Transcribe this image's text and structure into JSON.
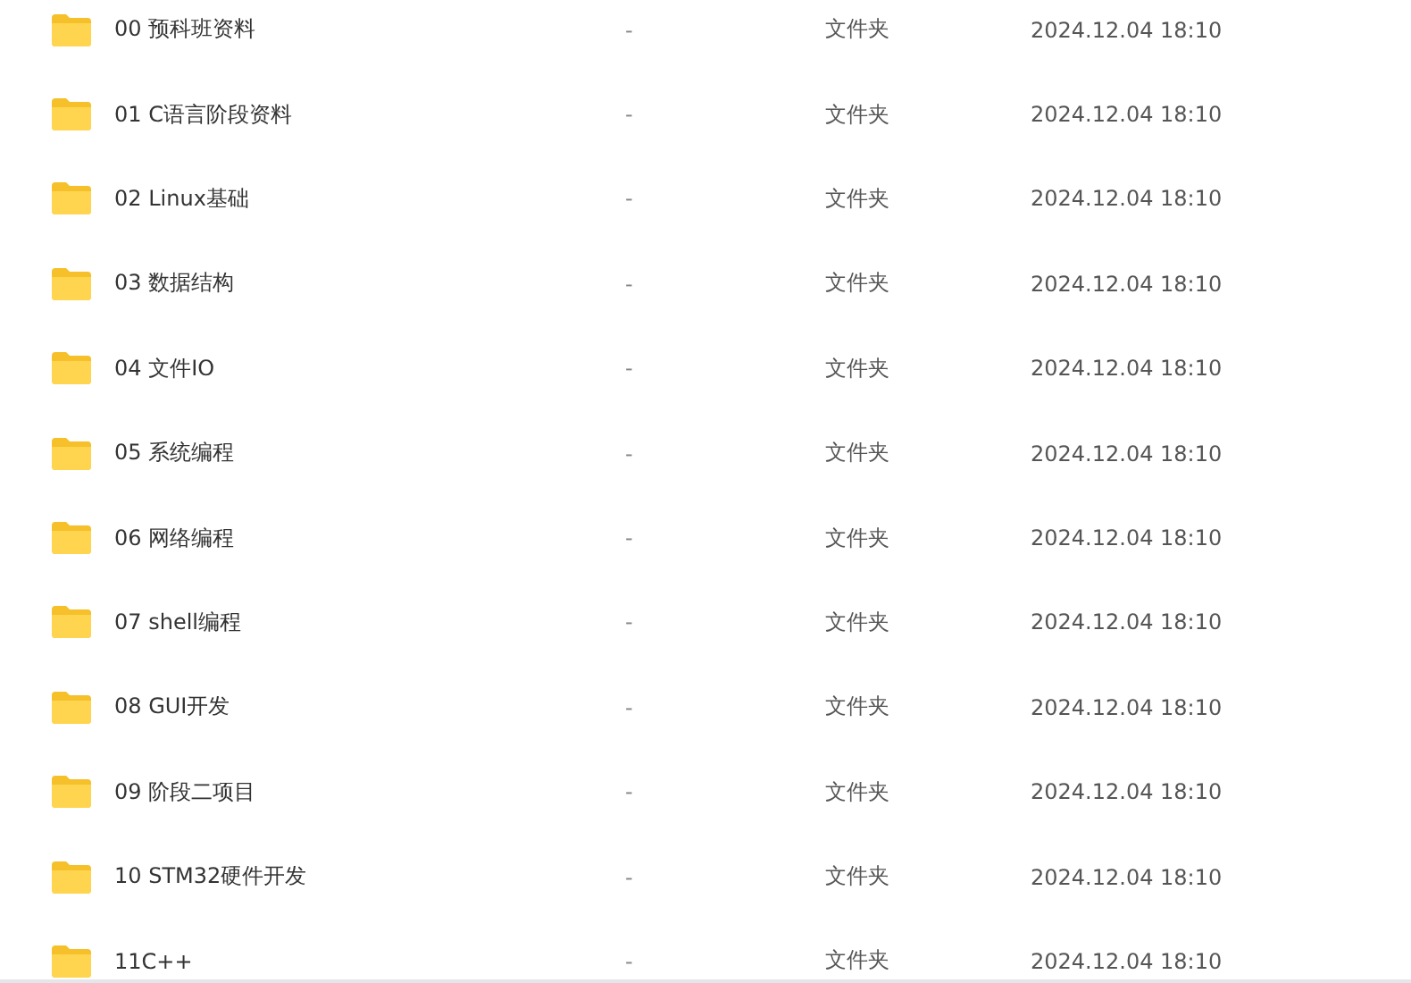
{
  "files": [
    {
      "name": "00 预科班资料",
      "size": "-",
      "type": "文件夹",
      "modified": "2024.12.04 18:10"
    },
    {
      "name": "01 C语言阶段资料",
      "size": "-",
      "type": "文件夹",
      "modified": "2024.12.04 18:10"
    },
    {
      "name": "02 Linux基础",
      "size": "-",
      "type": "文件夹",
      "modified": "2024.12.04 18:10"
    },
    {
      "name": "03 数据结构",
      "size": "-",
      "type": "文件夹",
      "modified": "2024.12.04 18:10"
    },
    {
      "name": "04 文件IO",
      "size": "-",
      "type": "文件夹",
      "modified": "2024.12.04 18:10"
    },
    {
      "name": "05 系统编程",
      "size": "-",
      "type": "文件夹",
      "modified": "2024.12.04 18:10"
    },
    {
      "name": "06 网络编程",
      "size": "-",
      "type": "文件夹",
      "modified": "2024.12.04 18:10"
    },
    {
      "name": "07 shell编程",
      "size": "-",
      "type": "文件夹",
      "modified": "2024.12.04 18:10"
    },
    {
      "name": "08 GUI开发",
      "size": "-",
      "type": "文件夹",
      "modified": "2024.12.04 18:10"
    },
    {
      "name": "09 阶段二项目",
      "size": "-",
      "type": "文件夹",
      "modified": "2024.12.04 18:10"
    },
    {
      "name": "10 STM32硬件开发",
      "size": "-",
      "type": "文件夹",
      "modified": "2024.12.04 18:10"
    },
    {
      "name": "11C++",
      "size": "-",
      "type": "文件夹",
      "modified": "2024.12.04 18:10"
    }
  ]
}
